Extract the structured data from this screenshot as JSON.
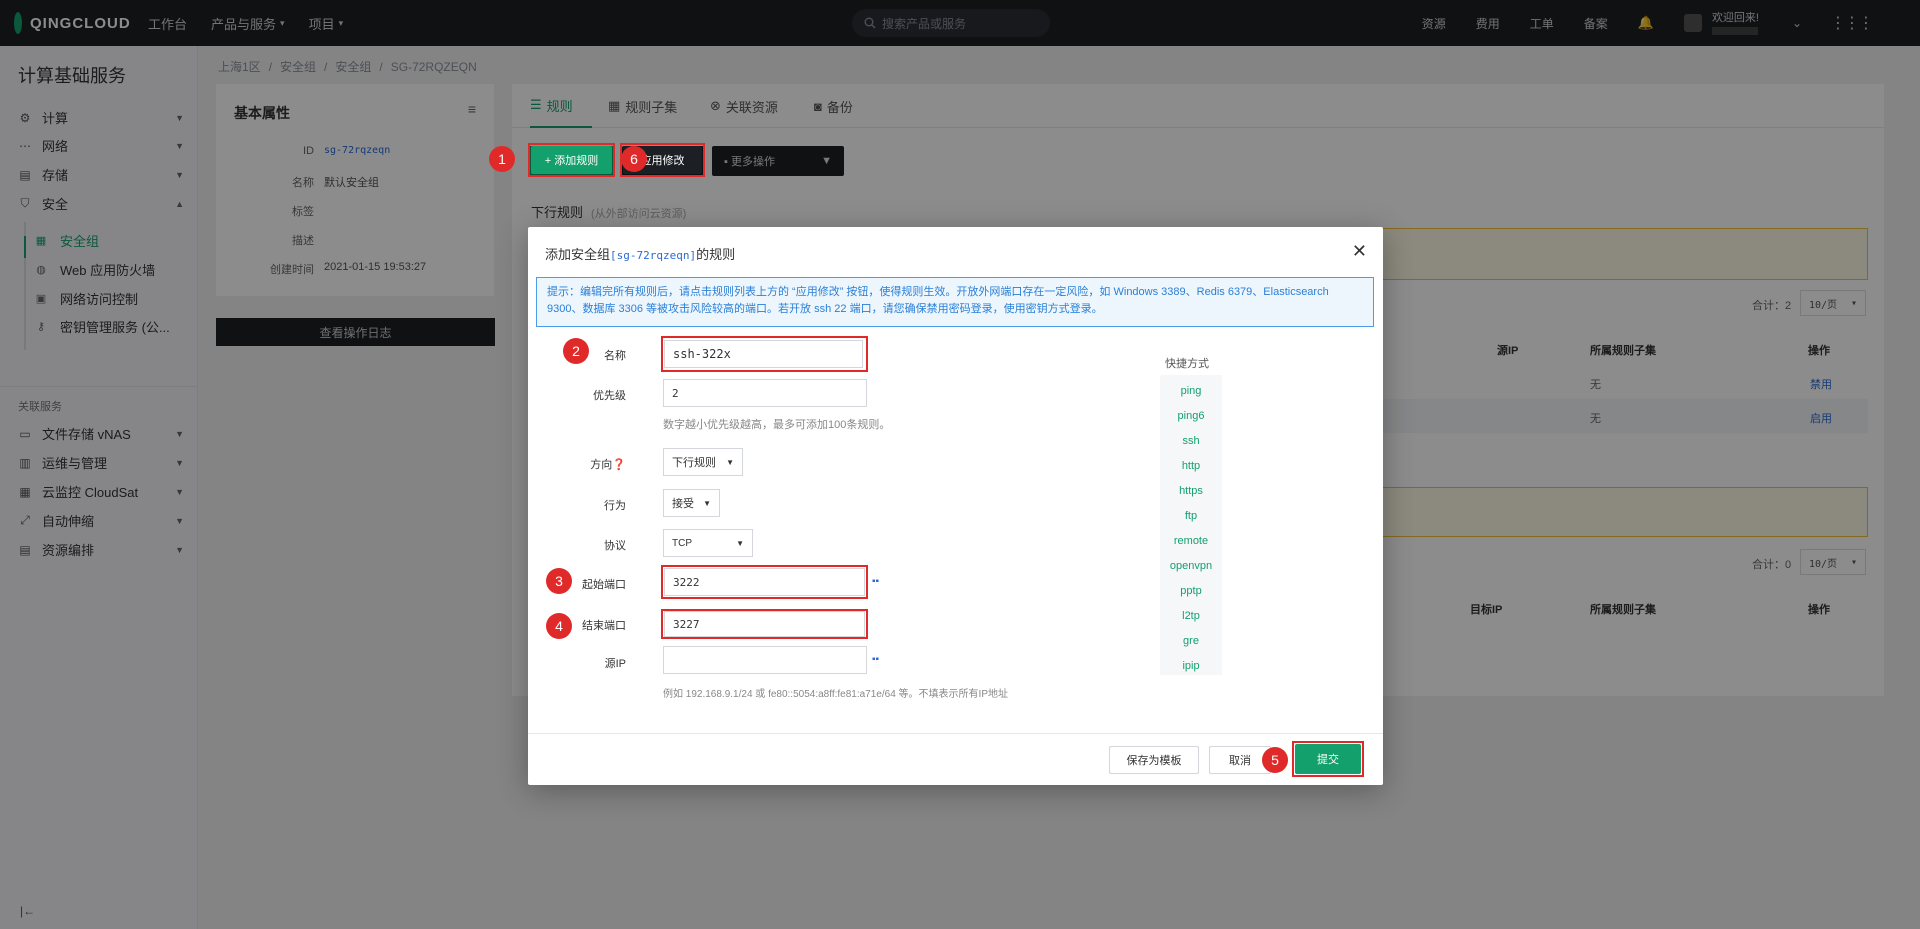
{
  "topbar": {
    "brand": "QINGCLOUD",
    "nav": [
      "工作台",
      "产品与服务",
      "项目"
    ],
    "search_placeholder": "搜索产品或服务",
    "right": [
      "资源",
      "费用",
      "工单",
      "备案"
    ],
    "greeting": "欢迎回来!"
  },
  "sidebar": {
    "title": "计算基础服务",
    "groups": [
      {
        "label": "计算",
        "icon": "cpu-icon"
      },
      {
        "label": "网络",
        "icon": "network-icon"
      },
      {
        "label": "存储",
        "icon": "storage-icon"
      },
      {
        "label": "安全",
        "icon": "shield-icon"
      }
    ],
    "security_items": [
      {
        "label": "安全组",
        "icon": "security-group-icon"
      },
      {
        "label": "Web 应用防火墙",
        "icon": "globe-icon"
      },
      {
        "label": "网络访问控制",
        "icon": "access-control-icon"
      },
      {
        "label": "密钥管理服务 (公...",
        "icon": "key-icon"
      }
    ],
    "related_title": "关联服务",
    "related": [
      {
        "label": "文件存储 vNAS",
        "icon": "file-storage-icon"
      },
      {
        "label": "运维与管理",
        "icon": "ops-icon"
      },
      {
        "label": "云监控 CloudSat",
        "icon": "monitor-icon"
      },
      {
        "label": "自动伸缩",
        "icon": "autoscale-icon"
      },
      {
        "label": "资源编排",
        "icon": "orchestration-icon"
      }
    ],
    "collapse": "|←"
  },
  "breadcrumb": [
    "上海1区",
    "安全组",
    "安全组",
    "SG-72RQZEQN"
  ],
  "basic": {
    "title": "基本属性",
    "rows": [
      {
        "k": "ID",
        "v": "sg-72rqzeqn"
      },
      {
        "k": "名称",
        "v": "默认安全组"
      },
      {
        "k": "标签",
        "v": ""
      },
      {
        "k": "描述",
        "v": ""
      },
      {
        "k": "创建时间",
        "v": "2021-01-15 19:53:27"
      }
    ],
    "log_button": "查看操作日志"
  },
  "tabs": [
    "规则",
    "规则子集",
    "关联资源",
    "备份"
  ],
  "toolbar": {
    "add": "+ 添加规则",
    "apply": "应用修改",
    "more": "更多操作"
  },
  "section": {
    "title": "下行规则",
    "subtitle": "(从外部访问云资源)"
  },
  "background_table": {
    "total1": "合计：2",
    "pager": "10/页",
    "total2": "合计：0",
    "head1": [
      "源IP",
      "所属规则子集",
      "操作"
    ],
    "head2": [
      "目标IP",
      "所属规则子集",
      "操作"
    ],
    "rows": [
      {
        "subset": "无",
        "op": "禁用"
      },
      {
        "subset": "无",
        "op": "启用"
      }
    ]
  },
  "modal": {
    "title_prefix": "添加安全组",
    "title_code": "[sg-72rqzeqn]",
    "title_suffix": "的规则",
    "tip": "提示：编辑完所有规则后，请点击规则列表上方的 “应用修改” 按钮，使得规则生效。开放外网端口存在一定风险，如 Windows 3389、Redis 6379、Elasticsearch 9300、数据库 3306 等被攻击风险较高的端口。若开放 ssh 22 端口，请您确保禁用密码登录，使用密钥方式登录。",
    "fields": {
      "name_label": "名称",
      "name_value": "ssh-322x",
      "priority_label": "优先级",
      "priority_value": "2",
      "priority_hint": "数字越小优先级越高，最多可添加100条规则。",
      "direction_label": "方向❓",
      "direction_value": "下行规则",
      "action_label": "行为",
      "action_value": "接受",
      "protocol_label": "协议",
      "protocol_value": "TCP",
      "start_port_label": "起始端口",
      "start_port_value": "3222",
      "end_port_label": "结束端口",
      "end_port_value": "3227",
      "source_ip_label": "源IP",
      "source_ip_value": "",
      "source_ip_hint": "例如 192.168.9.1/24 或 fe80::5054:a8ff:fe81:a71e/64 等。不填表示所有IP地址"
    },
    "quick_title": "快捷方式",
    "quick": [
      "ping",
      "ping6",
      "ssh",
      "http",
      "https",
      "ftp",
      "remote",
      "openvpn",
      "pptp",
      "l2tp",
      "gre",
      "ipip"
    ],
    "buttons": {
      "save_template": "保存为模板",
      "cancel": "取消",
      "submit": "提交"
    }
  },
  "annotations": [
    "1",
    "2",
    "3",
    "4",
    "5",
    "6"
  ],
  "colors": {
    "brand_green": "#14a06d",
    "annotation_red": "#e02a2a",
    "topbar": "#1c1f24"
  }
}
